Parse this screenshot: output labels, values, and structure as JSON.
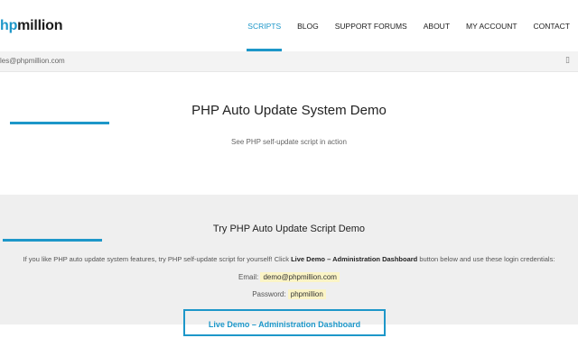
{
  "header": {
    "logo_accent": "hp",
    "logo_text": "million",
    "nav": [
      {
        "label": "SCRIPTS",
        "active": true
      },
      {
        "label": "BLOG"
      },
      {
        "label": "SUPPORT FORUMS"
      },
      {
        "label": "ABOUT"
      },
      {
        "label": "MY ACCOUNT"
      },
      {
        "label": "CONTACT"
      }
    ]
  },
  "topbar": {
    "email": "les@phpmillion.com",
    "menu_icon": "▯"
  },
  "hero": {
    "title": "PHP Auto Update System Demo",
    "subtitle": "See PHP self-update script in action"
  },
  "demo": {
    "title": "Try PHP Auto Update Script Demo",
    "intro_before": "If you like PHP auto update system features, try PHP self-update script for yourself! Click ",
    "intro_bold": "Live Demo – Administration Dashboard",
    "intro_after": " button below and use these login credentials:",
    "email_label": "Email:",
    "email_value": "demo@phpmillion.com",
    "password_label": "Password:",
    "password_value": "phpmillion",
    "button_label": "Live Demo – Administration Dashboard"
  },
  "colors": {
    "accent": "#1d97c9",
    "highlight": "#fbf4c6"
  }
}
